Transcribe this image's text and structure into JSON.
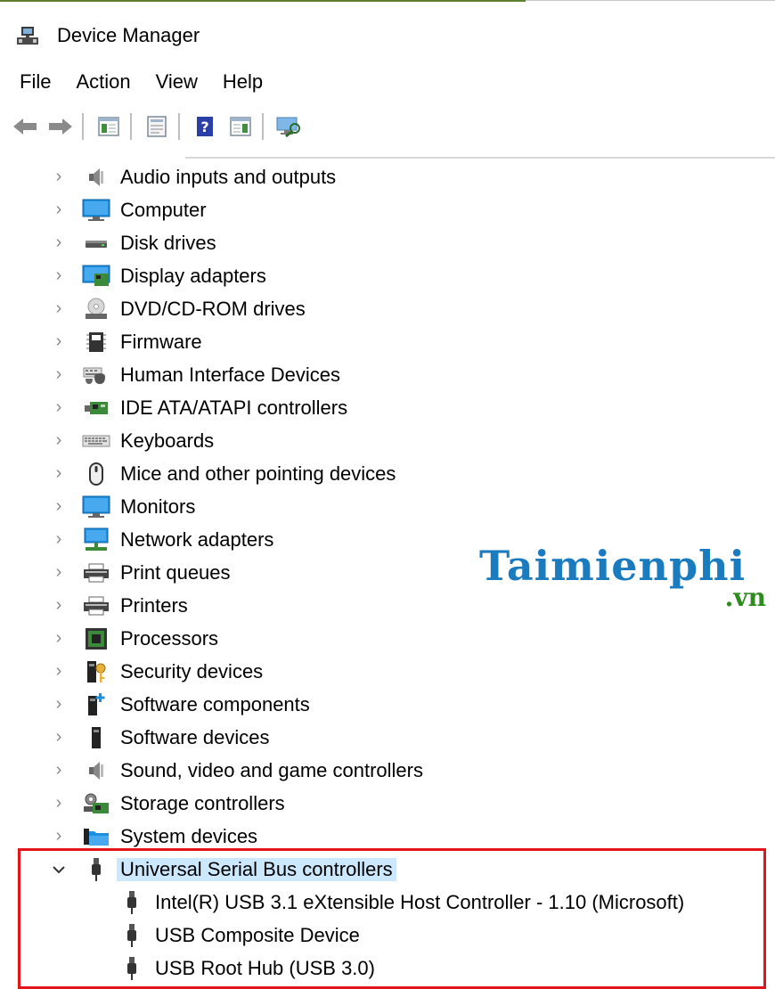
{
  "window": {
    "title": "Device Manager"
  },
  "menu": {
    "items": [
      "File",
      "Action",
      "View",
      "Help"
    ]
  },
  "toolbar": {
    "buttons": [
      "back-icon",
      "forward-icon",
      "show-hide-console-tree-icon",
      "properties-icon",
      "help-icon",
      "show-action-pane-icon",
      "scan-hardware-icon"
    ]
  },
  "tree": {
    "categories": [
      {
        "label": "Audio inputs and outputs",
        "icon": "speaker-icon",
        "expanded": false
      },
      {
        "label": "Computer",
        "icon": "computer-icon",
        "expanded": false
      },
      {
        "label": "Disk drives",
        "icon": "disk-drive-icon",
        "expanded": false
      },
      {
        "label": "Display adapters",
        "icon": "display-adapter-icon",
        "expanded": false
      },
      {
        "label": "DVD/CD-ROM drives",
        "icon": "dvd-drive-icon",
        "expanded": false
      },
      {
        "label": "Firmware",
        "icon": "firmware-chip-icon",
        "expanded": false
      },
      {
        "label": "Human Interface Devices",
        "icon": "hid-icon",
        "expanded": false
      },
      {
        "label": "IDE ATA/ATAPI controllers",
        "icon": "ide-controller-icon",
        "expanded": false
      },
      {
        "label": "Keyboards",
        "icon": "keyboard-icon",
        "expanded": false
      },
      {
        "label": "Mice and other pointing devices",
        "icon": "mouse-icon",
        "expanded": false
      },
      {
        "label": "Monitors",
        "icon": "monitor-icon",
        "expanded": false
      },
      {
        "label": "Network adapters",
        "icon": "network-adapter-icon",
        "expanded": false
      },
      {
        "label": "Print queues",
        "icon": "printer-icon",
        "expanded": false
      },
      {
        "label": "Printers",
        "icon": "printer-icon",
        "expanded": false
      },
      {
        "label": "Processors",
        "icon": "processor-icon",
        "expanded": false
      },
      {
        "label": "Security devices",
        "icon": "security-device-icon",
        "expanded": false
      },
      {
        "label": "Software components",
        "icon": "software-component-icon",
        "expanded": false
      },
      {
        "label": "Software devices",
        "icon": "software-device-icon",
        "expanded": false
      },
      {
        "label": "Sound, video and game controllers",
        "icon": "speaker-icon",
        "expanded": false
      },
      {
        "label": "Storage controllers",
        "icon": "storage-controller-icon",
        "expanded": false
      },
      {
        "label": "System devices",
        "icon": "folder-icon",
        "expanded": false
      },
      {
        "label": "Universal Serial Bus controllers",
        "icon": "usb-icon",
        "expanded": true,
        "selected": true,
        "children": [
          {
            "label": "Intel(R) USB 3.1 eXtensible Host Controller - 1.10 (Microsoft)",
            "icon": "usb-icon"
          },
          {
            "label": "USB Composite Device",
            "icon": "usb-icon"
          },
          {
            "label": "USB Root Hub (USB 3.0)",
            "icon": "usb-icon"
          }
        ]
      }
    ]
  },
  "watermark": {
    "main": "Taimienphi",
    "sub": ".vn"
  },
  "colors": {
    "selection": "#cce8ff",
    "highlight_border": "#e4141b",
    "watermark_blue": "#1a7bbf",
    "watermark_green": "#2e8b1e"
  }
}
